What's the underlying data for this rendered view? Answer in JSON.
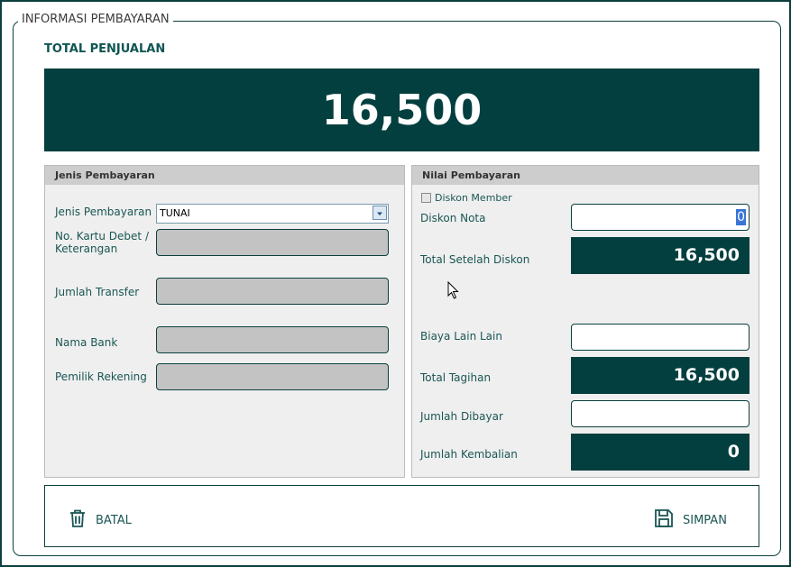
{
  "group_title": "INFORMASI PEMBAYARAN",
  "total": {
    "label": "TOTAL PENJUALAN",
    "value": "16,500"
  },
  "jenis_panel": {
    "title": "Jenis Pembayaran",
    "jenis_label": "Jenis Pembayaran",
    "jenis_value": "TUNAI",
    "kartu_label_1": "No. Kartu Debet /",
    "kartu_label_2": "Keterangan",
    "transfer_label": "Jumlah Transfer",
    "bank_label": "Nama Bank",
    "pemilik_label": "Pemilik Rekening"
  },
  "nilai_panel": {
    "title": "Nilai Pembayaran",
    "diskon_member_label": "Diskon Member",
    "diskon_member_checked": false,
    "diskon_nota_label": "Diskon Nota",
    "diskon_nota_value": "0",
    "total_setelah_label": "Total Setelah Diskon",
    "total_setelah_value": "16,500",
    "biaya_label": "Biaya Lain Lain",
    "biaya_value": "",
    "tagihan_label": "Total Tagihan",
    "tagihan_value": "16,500",
    "dibayar_label": "Jumlah Dibayar",
    "dibayar_value": "",
    "kembalian_label": "Jumlah Kembalian",
    "kembalian_value": "0"
  },
  "footer": {
    "batal_label": "BATAL",
    "simpan_label": "SIMPAN"
  },
  "colors": {
    "primary_dark": "#033f3e",
    "label_text": "#1a5654",
    "field_gray": "#c3c3c3"
  },
  "icons": {
    "batal": "trash-icon",
    "simpan": "save-icon",
    "dropdown": "chevron-down-icon",
    "pointer": "mouse-cursor-icon"
  }
}
